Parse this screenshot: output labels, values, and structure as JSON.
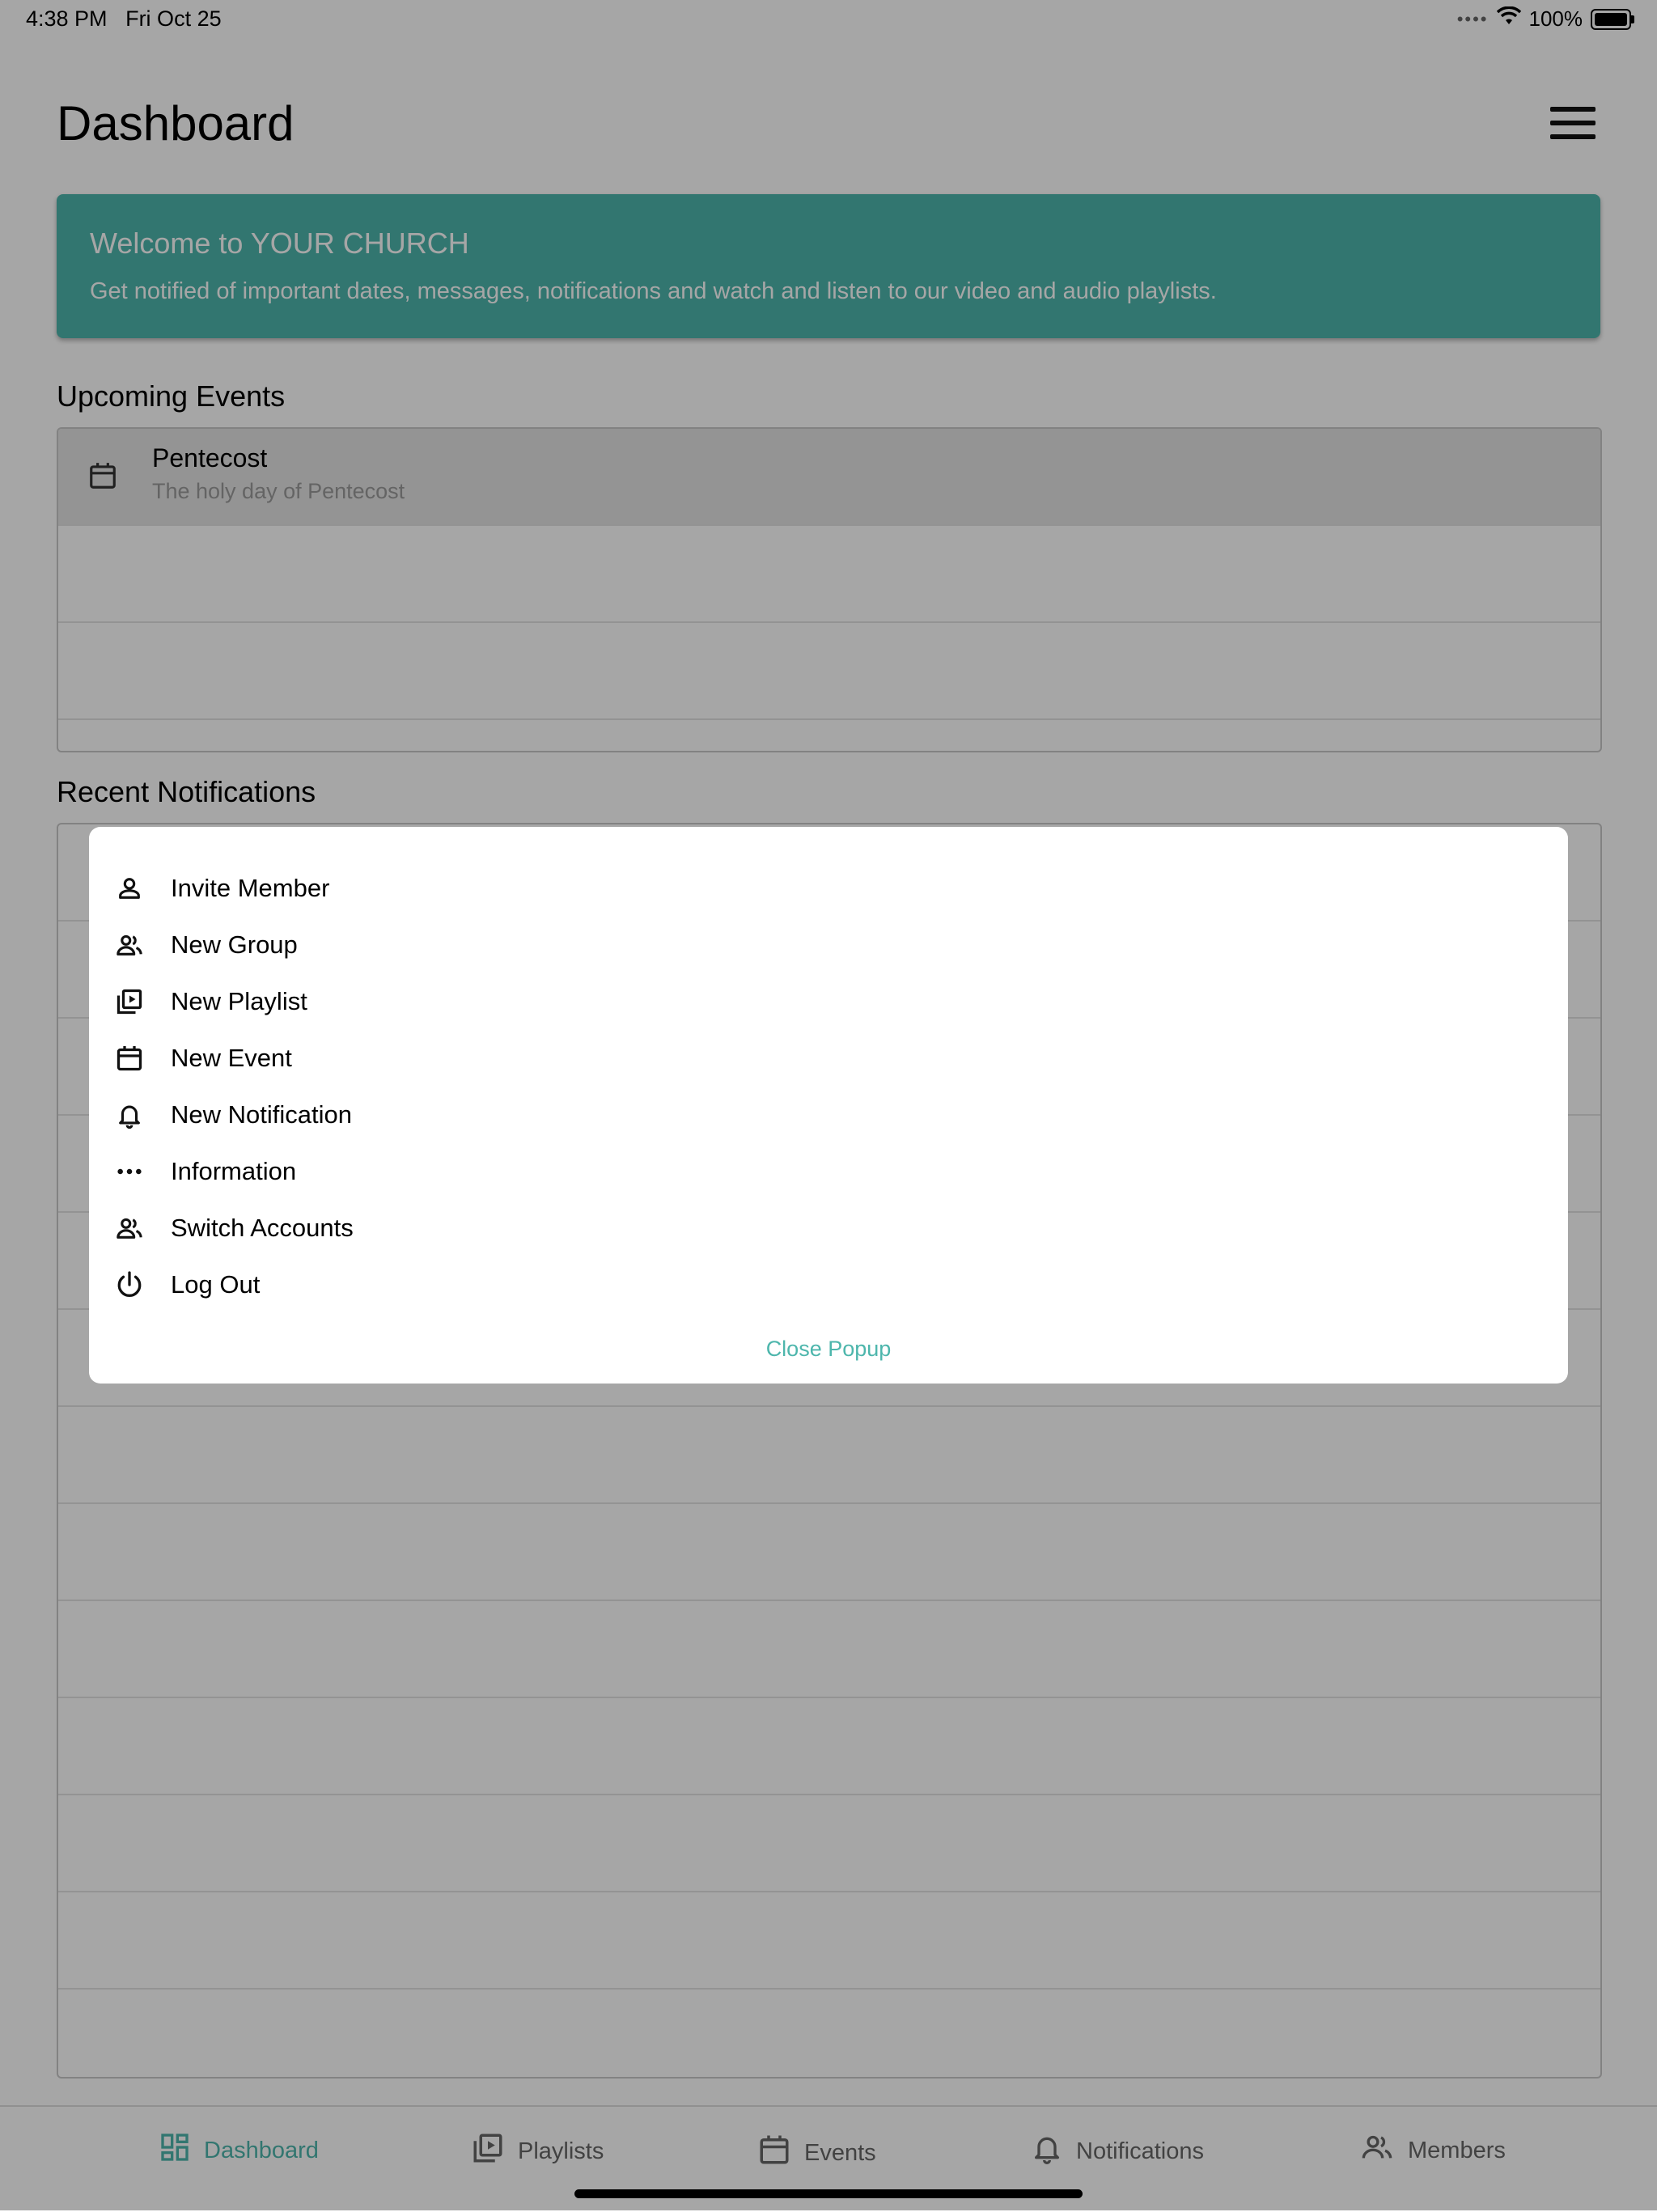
{
  "status_bar": {
    "time": "4:38 PM",
    "date": "Fri Oct 25",
    "battery": "100%"
  },
  "header": {
    "title": "Dashboard"
  },
  "welcome": {
    "title": "Welcome to YOUR CHURCH",
    "subtitle": "Get notified of important dates, messages, notifications and watch and listen to our video and audio playlists."
  },
  "upcoming_events": {
    "title": "Upcoming Events",
    "items": [
      {
        "name": "Pentecost",
        "description": "The holy day of Pentecost"
      }
    ]
  },
  "recent_notifications": {
    "title": "Recent Notifications"
  },
  "popup": {
    "items": [
      {
        "label": "Invite Member",
        "icon": "person-icon"
      },
      {
        "label": "New Group",
        "icon": "group-icon"
      },
      {
        "label": "New Playlist",
        "icon": "playlist-icon"
      },
      {
        "label": "New Event",
        "icon": "calendar-icon"
      },
      {
        "label": "New Notification",
        "icon": "bell-icon"
      },
      {
        "label": "Information",
        "icon": "more-horizontal-icon"
      },
      {
        "label": "Switch Accounts",
        "icon": "group-icon"
      },
      {
        "label": "Log Out",
        "icon": "power-icon"
      }
    ],
    "close_label": "Close Popup"
  },
  "tabs": [
    {
      "label": "Dashboard",
      "icon": "dashboard-icon",
      "active": true
    },
    {
      "label": "Playlists",
      "icon": "playlist-icon"
    },
    {
      "label": "Events",
      "icon": "calendar-icon"
    },
    {
      "label": "Notifications",
      "icon": "bell-icon"
    },
    {
      "label": "Members",
      "icon": "group-icon"
    }
  ],
  "colors": {
    "accent": "#4db6ac",
    "overlay": "rgba(0,0,0,0.35)"
  }
}
